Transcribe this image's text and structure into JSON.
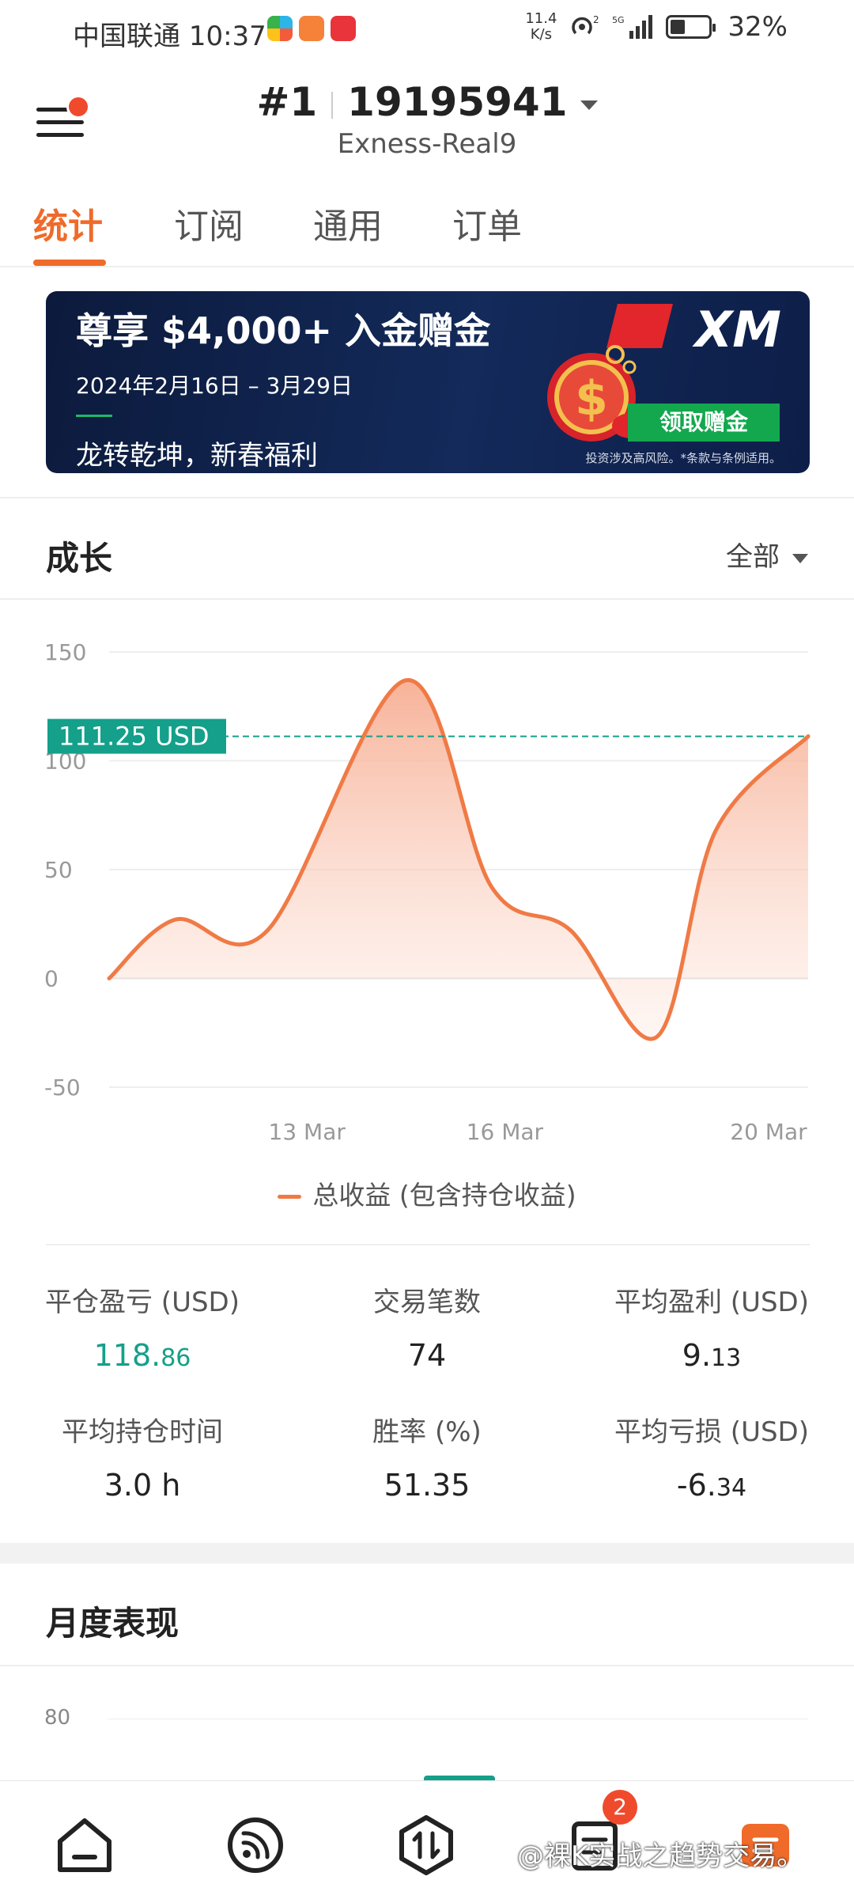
{
  "status_bar": {
    "carrier": "中国联通",
    "time": "10:37",
    "net_speed_value": "11.4",
    "net_speed_unit": "K/s",
    "battery": "32%"
  },
  "header": {
    "account_rank": "#1",
    "account_number": "19195941",
    "server": "Exness-Real9"
  },
  "tabs": [
    {
      "label": "统计",
      "active": true
    },
    {
      "label": "订阅",
      "active": false
    },
    {
      "label": "通用",
      "active": false
    },
    {
      "label": "订单",
      "active": false
    }
  ],
  "banner": {
    "headline": "尊享 $4,000+ 入金赠金",
    "dates": "2024年2月16日 – 3月29日",
    "slogan": "龙转乾坤，新春福利",
    "brand": "XM",
    "cta": "领取赠金",
    "disclaimer": "投资涉及高风险。*条款与条例适用。"
  },
  "growth": {
    "title": "成长",
    "range_label": "全部",
    "current_value_label": "111.25 USD",
    "legend": "总收益 (包含持仓收益)"
  },
  "chart_data": {
    "type": "area",
    "title": "",
    "xlabel": "",
    "ylabel": "",
    "ylim": [
      -50,
      150
    ],
    "yticks": [
      150,
      100,
      50,
      0,
      -50
    ],
    "xticks": [
      "13 Mar",
      "16 Mar",
      "20 Mar"
    ],
    "grid": true,
    "legend_position": "bottom",
    "color": "#f07a45",
    "current_value": 111.25,
    "series": [
      {
        "name": "总收益 (包含持仓收益)",
        "points": [
          {
            "x": "10 Mar",
            "y": 0
          },
          {
            "x": "11 Mar",
            "y": 27
          },
          {
            "x": "12.4 Mar",
            "y": 22
          },
          {
            "x": "14.5 Mar",
            "y": 137
          },
          {
            "x": "15.8 Mar",
            "y": 42
          },
          {
            "x": "17 Mar",
            "y": 22
          },
          {
            "x": "18.3 Mar",
            "y": -27
          },
          {
            "x": "19.2 Mar",
            "y": 68
          },
          {
            "x": "20.6 Mar",
            "y": 111.25
          }
        ]
      }
    ]
  },
  "stats": {
    "closed_pl": {
      "label": "平仓盈亏 (USD)",
      "value_main": "118.",
      "value_small": "86"
    },
    "trades": {
      "label": "交易笔数",
      "value": "74"
    },
    "avg_profit": {
      "label": "平均盈利 (USD)",
      "value_main": "9.",
      "value_small": "13"
    },
    "avg_hold": {
      "label": "平均持仓时间",
      "value": "3.0 h"
    },
    "win_rate": {
      "label": "胜率 (%)",
      "value": "51.35"
    },
    "avg_loss": {
      "label": "平均亏损 (USD)",
      "value_main": "-6.",
      "value_small": "34"
    }
  },
  "monthly": {
    "title": "月度表现",
    "first_tick": "80"
  },
  "bottom_nav": {
    "items": [
      "home-icon",
      "feed-icon",
      "trade-icon",
      "orders-icon",
      "calendar-icon"
    ],
    "badge": "2"
  },
  "watermark": "@裸K实战之趋势交易。"
}
